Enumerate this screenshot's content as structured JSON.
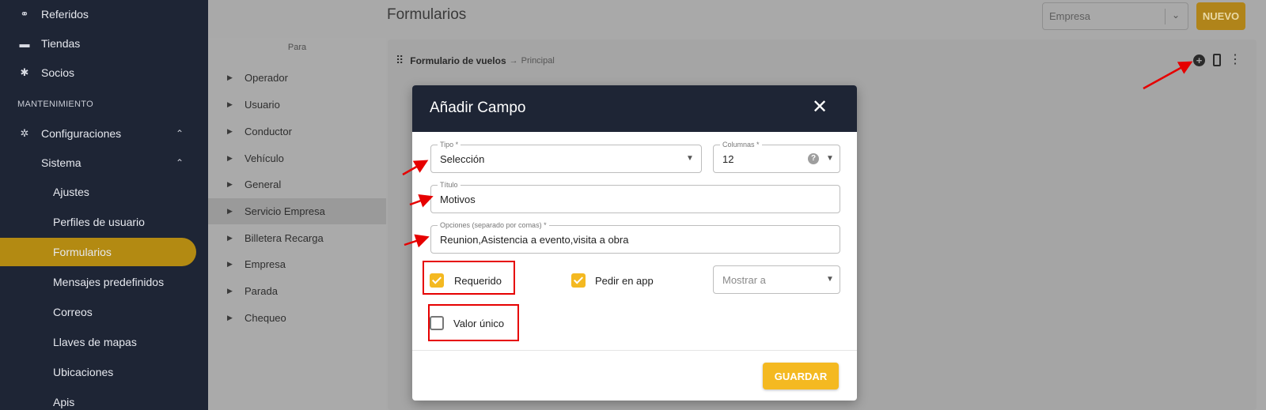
{
  "sidebar": {
    "items": [
      {
        "label": "Referidos",
        "icon": "referrals-icon",
        "glyph": "⚭"
      },
      {
        "label": "Tiendas",
        "icon": "store-icon",
        "glyph": "▬"
      },
      {
        "label": "Socios",
        "icon": "partners-icon",
        "glyph": "✱"
      }
    ],
    "section": "MANTENIMIENTO",
    "config": {
      "label": "Configuraciones",
      "icon": "gear-icon",
      "glyph": "✲",
      "chevron": "⌃"
    },
    "sistema": {
      "label": "Sistema",
      "chevron": "⌃"
    },
    "subitems": [
      {
        "label": "Ajustes"
      },
      {
        "label": "Perfiles de usuario"
      },
      {
        "label": "Formularios",
        "active": true
      },
      {
        "label": "Mensajes predefinidos"
      },
      {
        "label": "Correos"
      },
      {
        "label": "Llaves de mapas"
      },
      {
        "label": "Ubicaciones"
      },
      {
        "label": "Apis"
      }
    ]
  },
  "page": {
    "title": "Formularios",
    "company_select": "Empresa",
    "select_arrow": "⌄",
    "new_button": "NUEVO"
  },
  "para": {
    "header": "Para",
    "items": [
      "Operador",
      "Usuario",
      "Conductor",
      "Vehículo",
      "General",
      "Servicio Empresa",
      "Billetera Recarga",
      "Empresa",
      "Parada",
      "Chequeo"
    ],
    "selected": "Servicio Empresa",
    "tri": "▶"
  },
  "form_panel": {
    "drag_glyph": "⠿",
    "name": "Formulario de vuelos",
    "arrow": "→",
    "subtitle": "Principal",
    "kebab": "⋮",
    "plus": "+"
  },
  "modal": {
    "title": "Añadir Campo",
    "close": "✕",
    "tipo": {
      "label": "Tipo *",
      "value": "Selección"
    },
    "columnas": {
      "label": "Columnas *",
      "value": "12",
      "help": "?"
    },
    "titulo": {
      "label": "Título",
      "value": "Motivos"
    },
    "opciones": {
      "label": "Opciones (separado por comas) *",
      "value": "Reunion,Asistencia a evento,visita a obra"
    },
    "requerido": {
      "label": "Requerido",
      "checked": true
    },
    "pedir_app": {
      "label": "Pedir en app",
      "checked": true
    },
    "mostrar_a": {
      "placeholder": "Mostrar a"
    },
    "valor_unico": {
      "label": "Valor único",
      "checked": false
    },
    "dropdown_arrow": "▼",
    "save_button": "GUARDAR"
  },
  "colors": {
    "sidebar_bg": "#1e2535",
    "accent": "#f4b921",
    "annotation": "#e60000"
  }
}
